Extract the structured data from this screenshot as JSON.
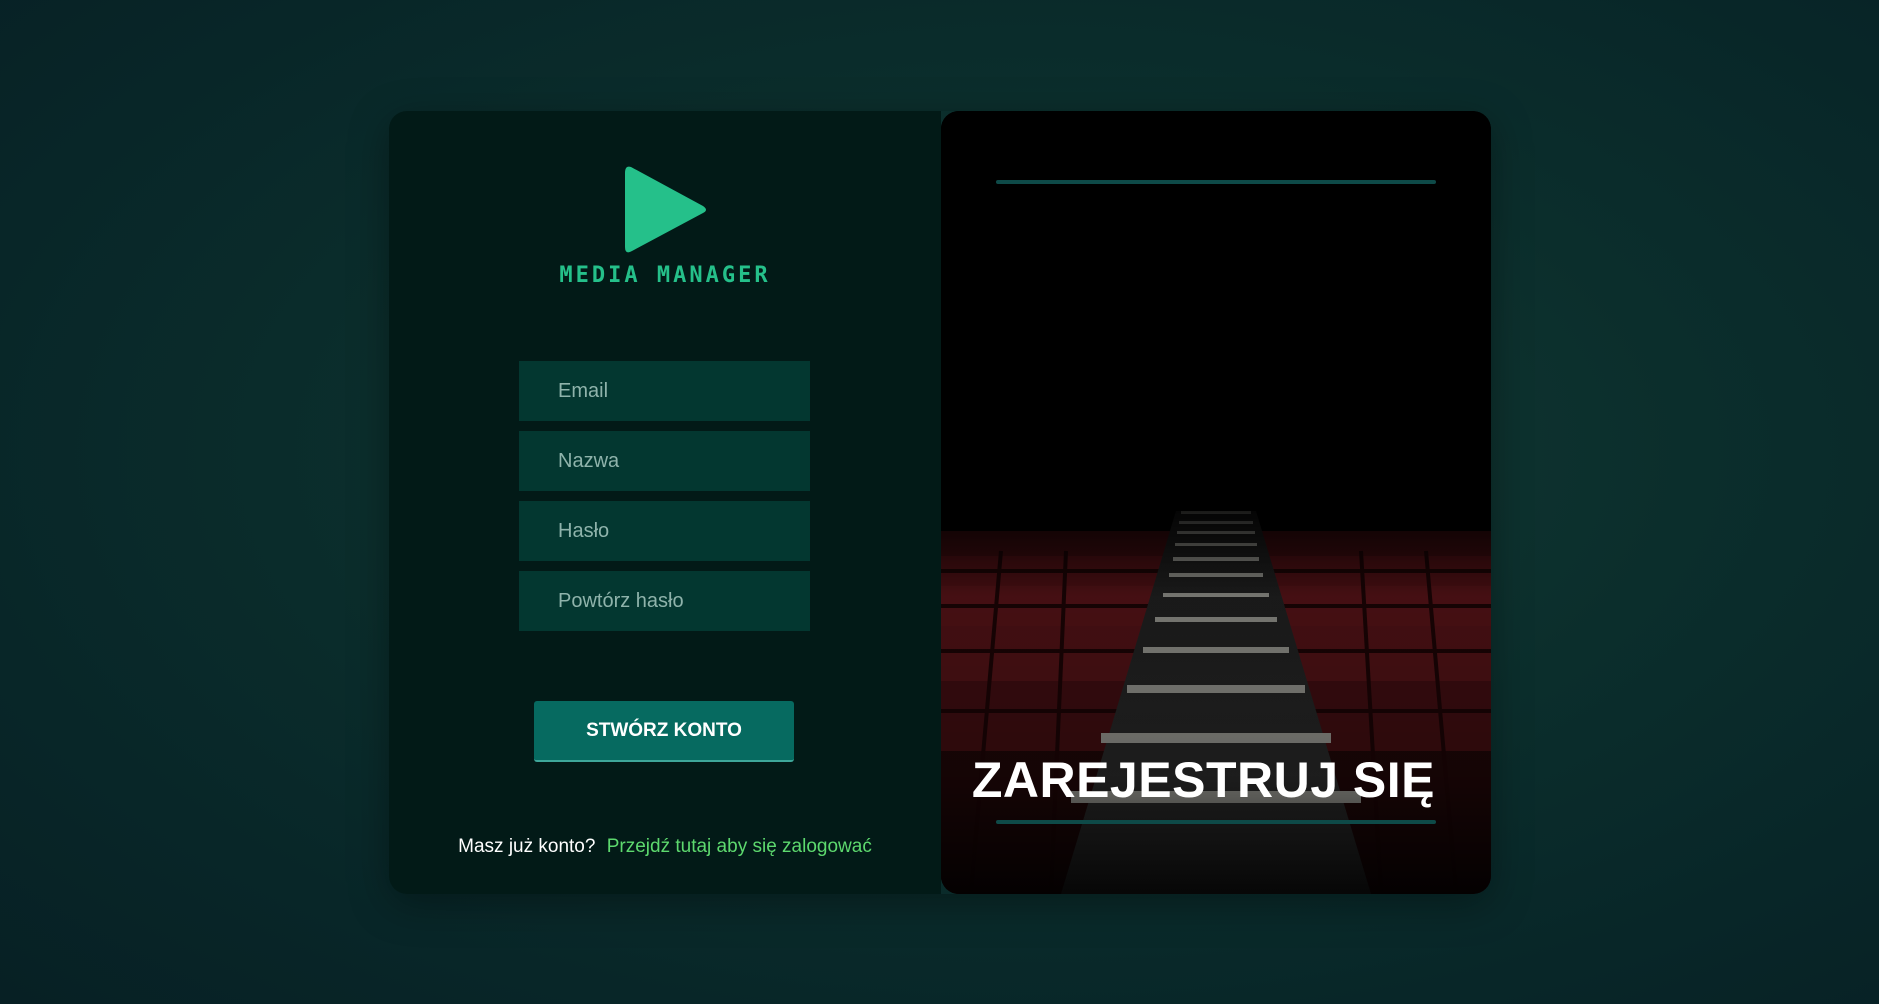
{
  "brand": {
    "name": "MEDIA MANAGER",
    "accent_color": "#25c08a",
    "logo_icon": "play-icon"
  },
  "form": {
    "email_placeholder": "Email",
    "name_placeholder": "Nazwa",
    "password_placeholder": "Hasło",
    "repeat_password_placeholder": "Powtórz hasło",
    "submit_label": "STWÓRZ KONTO"
  },
  "login_prompt": {
    "question": "Masz już konto?",
    "link_text": "Przejdź tutaj aby się zalogować"
  },
  "hero": {
    "headline": "ZAREJESTRUJ SIĘ"
  }
}
